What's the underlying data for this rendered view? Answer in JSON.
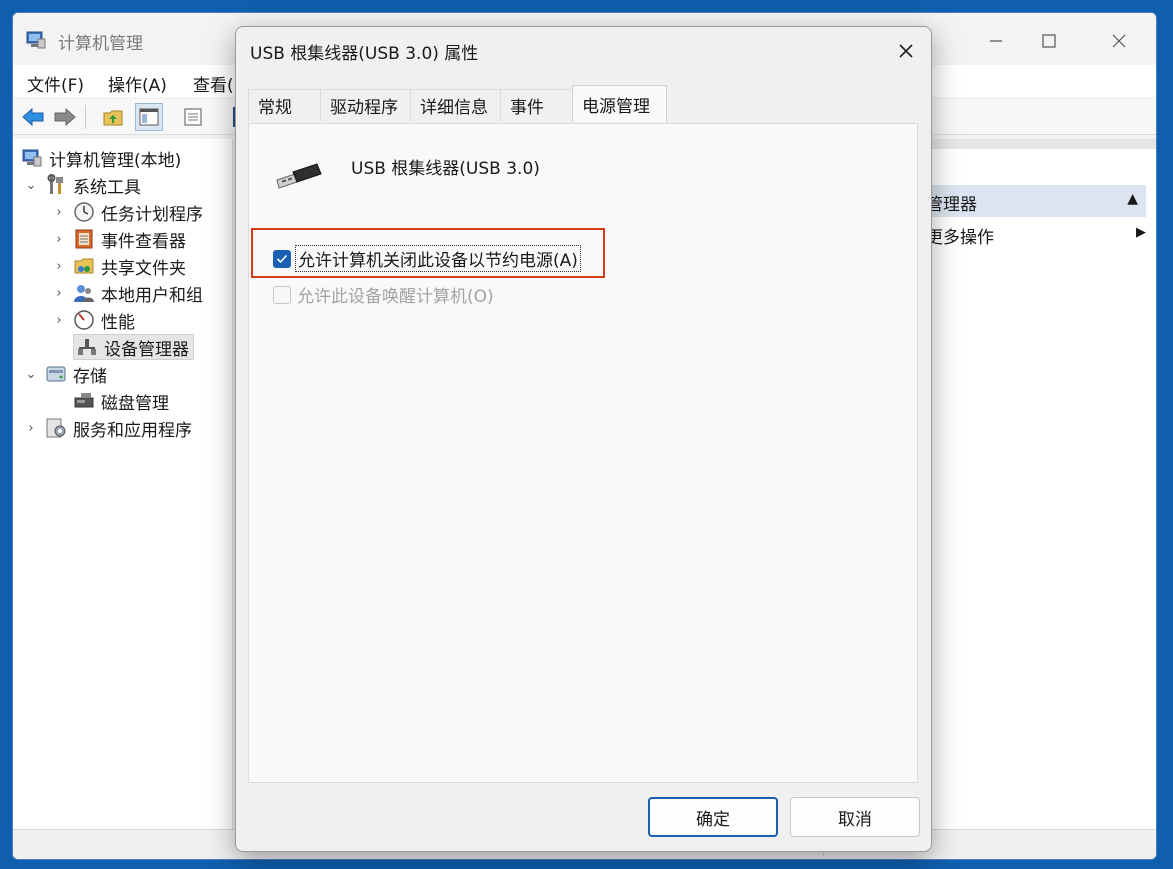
{
  "main_window": {
    "title": "计算机管理",
    "menu": [
      "文件(F)",
      "操作(A)",
      "查看("
    ],
    "tree": [
      {
        "label": "计算机管理(本地)"
      },
      {
        "label": "系统工具"
      },
      {
        "label": "任务计划程序"
      },
      {
        "label": "事件查看器"
      },
      {
        "label": "共享文件夹"
      },
      {
        "label": "本地用户和组"
      },
      {
        "label": "性能"
      },
      {
        "label": "设备管理器"
      },
      {
        "label": "存储"
      },
      {
        "label": "磁盘管理"
      },
      {
        "label": "服务和应用程序"
      }
    ],
    "actions": {
      "title": "管理器",
      "more": "更多操作"
    }
  },
  "dialog": {
    "title": "USB 根集线器(USB 3.0) 属性",
    "tabs": [
      "常规",
      "驱动程序",
      "详细信息",
      "事件",
      "电源管理"
    ],
    "active_tab": "电源管理",
    "device_name": "USB 根集线器(USB 3.0)",
    "options": [
      {
        "label": "允许计算机关闭此设备以节约电源(A)",
        "checked": true,
        "enabled": true
      },
      {
        "label": "允许此设备唤醒计算机(O)",
        "checked": false,
        "enabled": false
      }
    ],
    "ok_label": "确定",
    "cancel_label": "取消"
  },
  "colors": {
    "desktop": "#0f5fae",
    "accent": "#1b5fb3",
    "highlight_border": "#d93a1e"
  }
}
